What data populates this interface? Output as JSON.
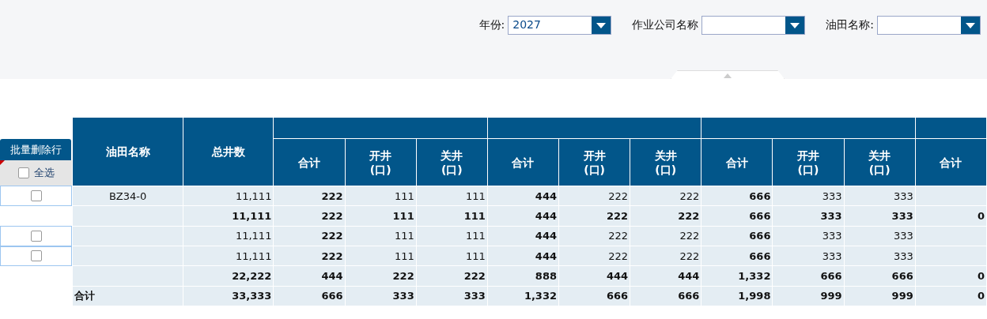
{
  "filters": [
    {
      "label": "年份:",
      "value": "2027"
    },
    {
      "label": "作业公司名称"
    },
    {
      "label": "油田名称:"
    }
  ],
  "actions": {
    "delete_button": "批量删除行",
    "select_all": {
      "label": "全选",
      "checked": false
    }
  },
  "table": {
    "columns": [
      "油田名称",
      "总井数"
    ],
    "groups": [
      {
        "columns": [
          "合计",
          "开井\n(口)",
          "关井\n(口)"
        ]
      },
      {
        "columns": [
          "合计",
          "开井\n(口)",
          "关井\n(口)"
        ]
      },
      {
        "columns": [
          "合计",
          "开井\n(口)",
          "关井\n(口)"
        ]
      },
      {
        "columns": [
          "合计"
        ]
      }
    ],
    "rows": [
      {
        "kind": "item",
        "checked": false,
        "cells": [
          "BZ34-0",
          "11,111",
          "222",
          "111",
          "111",
          "444",
          "222",
          "222",
          "666",
          "333",
          "333",
          ""
        ]
      },
      {
        "kind": "subtotal",
        "cells": [
          "",
          "11,111",
          "222",
          "111",
          "111",
          "444",
          "222",
          "222",
          "666",
          "333",
          "333",
          "0"
        ]
      },
      {
        "kind": "item",
        "checked": false,
        "cells": [
          "",
          "11,111",
          "222",
          "111",
          "111",
          "444",
          "222",
          "222",
          "666",
          "333",
          "333",
          ""
        ]
      },
      {
        "kind": "item",
        "checked": false,
        "cells": [
          "",
          "11,111",
          "222",
          "111",
          "111",
          "444",
          "222",
          "222",
          "666",
          "333",
          "333",
          ""
        ]
      },
      {
        "kind": "subtotal",
        "cells": [
          "",
          "22,222",
          "444",
          "222",
          "222",
          "888",
          "444",
          "444",
          "1,332",
          "666",
          "666",
          "0"
        ]
      },
      {
        "kind": "total",
        "cells": [
          "合计",
          "33,333",
          "666",
          "333",
          "333",
          "1,332",
          "666",
          "666",
          "1,998",
          "999",
          "999",
          "0"
        ]
      }
    ]
  }
}
